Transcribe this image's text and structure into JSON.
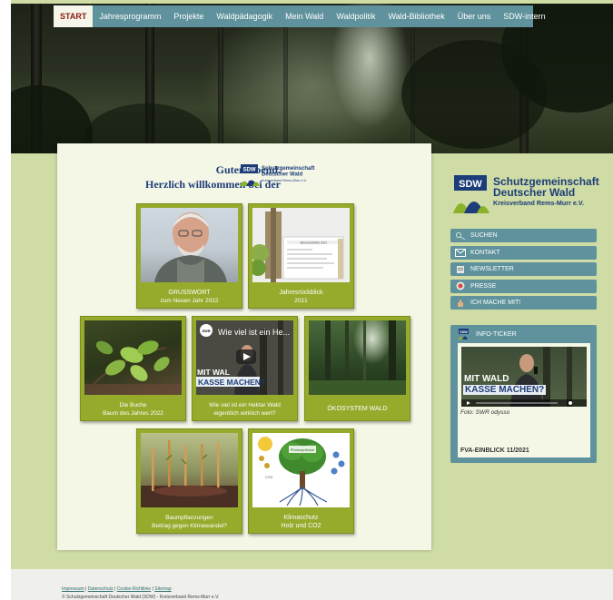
{
  "nav": {
    "items": [
      "START",
      "Jahresprogramm",
      "Projekte",
      "Waldpädagogik",
      "Mein Wald",
      "Waldpolitik",
      "Wald-Bibliothek",
      "Über uns",
      "SDW-intern"
    ]
  },
  "greeting": {
    "line1": "Guten Abend.",
    "line2": "Herzlich willkommen bei der"
  },
  "logo_small": {
    "abbr": "SDW",
    "line1": "Schutzgemeinschaft",
    "line2": "Deutscher Wald",
    "line3": "Kreisverband Rems-Murr e.V."
  },
  "logo_large": {
    "abbr": "SDW",
    "line1": "Schutzgemeinschaft",
    "line2": "Deutscher Wald",
    "line3": "Kreisverband Rems-Murr e.V."
  },
  "tiles": [
    {
      "title": "GRUSSWORT",
      "subtitle": "zum Neuen Jahr 2022"
    },
    {
      "title": "Jahresrückblick",
      "subtitle": "2021"
    },
    {
      "title": "Die Buche",
      "subtitle": "Baum des Jahres 2022"
    },
    {
      "title": "Wie viel ist ein Hektar Wald",
      "subtitle": "eigentlich wirklich wert?"
    },
    {
      "title": "ÖKOSYSTEM WALD",
      "subtitle": ""
    },
    {
      "title": "Baumpflanzungen",
      "subtitle": "Beitrag gegen Klimawandel?"
    },
    {
      "title": "Klimaschutz",
      "subtitle": "Holz und CO2"
    }
  ],
  "video": {
    "channel": "SWR",
    "title": "Wie viel ist ein He...",
    "overlay1": "MIT WAL",
    "overlay2": "KASSE MACHEN?"
  },
  "doc_thumb": {
    "label": "Jahresrückblick 2021"
  },
  "climate_thumb": {
    "label": "Photosynthese",
    "co2": "CO2"
  },
  "sidebar": {
    "menu": [
      {
        "label": "SUCHEN",
        "icon": "search-icon"
      },
      {
        "label": "KONTAKT",
        "icon": "mail-icon"
      },
      {
        "label": "NEWSLETTER",
        "icon": "newsletter-icon"
      },
      {
        "label": "PRESSE",
        "icon": "press-icon"
      },
      {
        "label": "ICH MACHE MIT!",
        "icon": "hand-icon"
      }
    ]
  },
  "ticker": {
    "header": "INFO-TICKER",
    "video_overlay1": "MIT WALD",
    "video_overlay2": "KASSE MACHEN?",
    "caption": "Foto: SWR odysso",
    "title": "FVA-EINBLICK 11/2021"
  },
  "footer": {
    "links": [
      "Impressum",
      "Datenschutz",
      "Cookie-Richtlinie",
      "Sitemap"
    ],
    "separator": " | ",
    "copyright": "© Schutzgemeinschaft Deutscher Wald (SDW) - Kreisverband Rems-Murr e.V."
  },
  "colors": {
    "nav_bg": "#5f929c",
    "accent_green": "#96aa2c",
    "page_bg": "#cfdca6",
    "brand_blue": "#1d3d78"
  }
}
